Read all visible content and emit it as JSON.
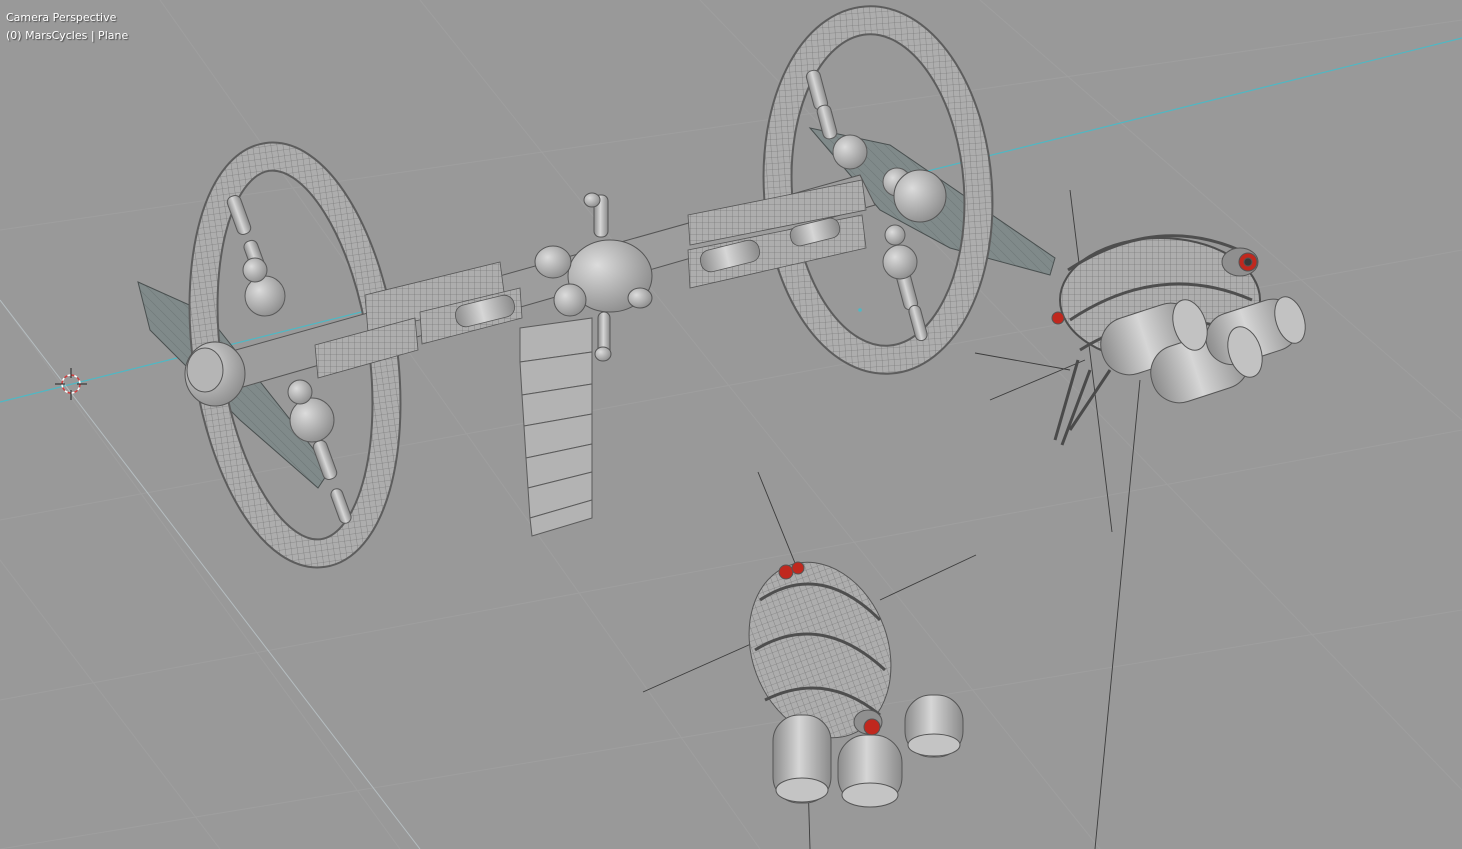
{
  "viewport": {
    "view_name": "Camera Perspective",
    "collection_label": "(0) MarsCycles | Plane"
  },
  "colors": {
    "background": "#999999",
    "grid_line": "#a3a3a3",
    "axis_x": "#4fb8c4",
    "axis_y_faint": "#b7c2c8",
    "mesh_fill": "#a9a9a9",
    "mesh_line": "#5a5a5a",
    "panel_fill": "#7f8a8a",
    "accent_red": "#c0281e",
    "text": "#ffffff"
  },
  "objects": [
    {
      "name": "space-station",
      "icon": "mesh-object"
    },
    {
      "name": "mars-cycler-right",
      "icon": "mesh-object"
    },
    {
      "name": "mars-cycler-bottom",
      "icon": "mesh-object"
    },
    {
      "name": "3d-cursor",
      "icon": "crosshair-icon"
    }
  ]
}
